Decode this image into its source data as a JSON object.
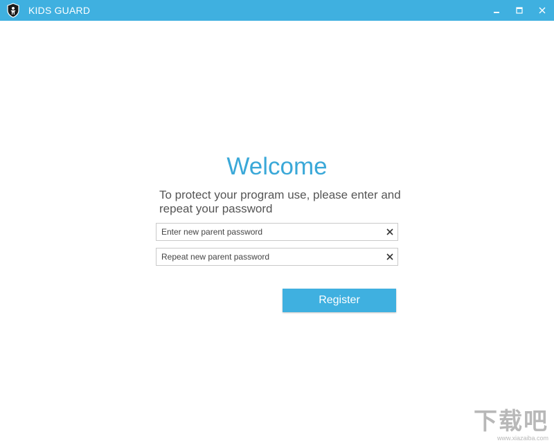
{
  "window": {
    "title": "KIDS GUARD",
    "icons": {
      "logo": "shield-child-icon",
      "minimize": "minimize-icon",
      "maximize": "maximize-icon",
      "close": "close-icon"
    }
  },
  "main": {
    "heading": "Welcome",
    "instructions": "To protect your program use, please enter and repeat your password",
    "password_field": {
      "placeholder": "Enter new parent password",
      "value": ""
    },
    "repeat_field": {
      "placeholder": "Repeat new parent password",
      "value": ""
    },
    "register_label": "Register"
  },
  "watermark": {
    "main": "下载吧",
    "sub": "www.xiazaiba.com"
  },
  "colors": {
    "accent": "#3fb0e0",
    "heading": "#3aa8d8",
    "text": "#555555",
    "border": "#c9c9c9"
  }
}
